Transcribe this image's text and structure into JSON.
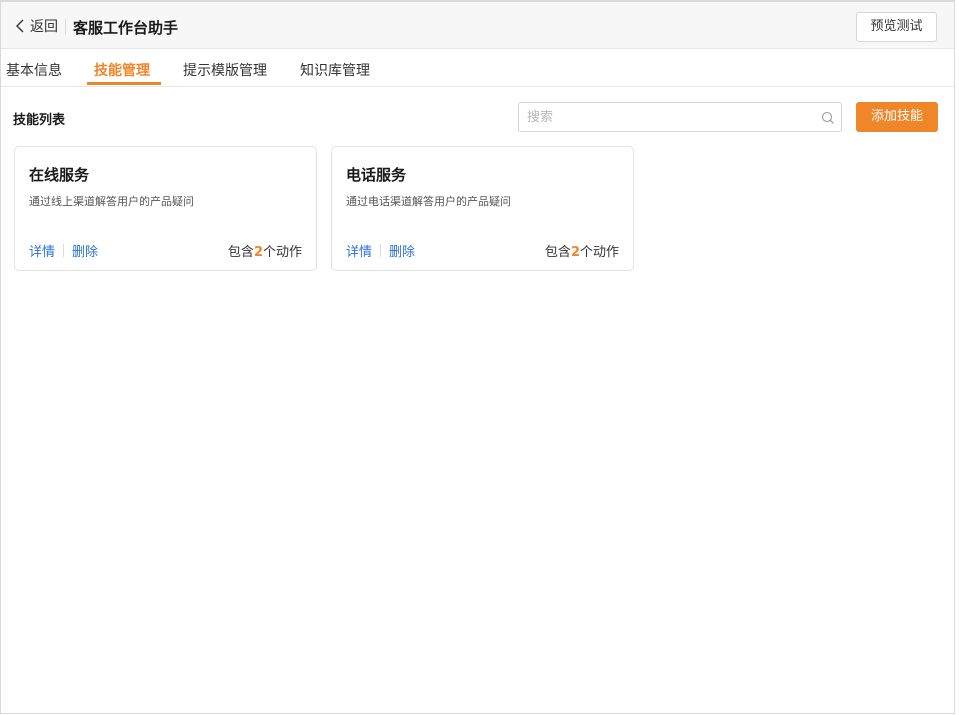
{
  "header": {
    "back_label": "返回",
    "title": "客服工作台助手",
    "preview_label": "预览测试"
  },
  "tabs": [
    {
      "label": "基本信息"
    },
    {
      "label": "技能管理"
    },
    {
      "label": "提示模版管理"
    },
    {
      "label": "知识库管理"
    }
  ],
  "active_tab": "技能管理",
  "skills": {
    "section_title": "技能列表",
    "search_placeholder": "搜索",
    "add_label": "添加技能",
    "cards": [
      {
        "title": "在线服务",
        "description": "通过线上渠道解答用户的产品疑问",
        "detail_label": "详情",
        "delete_label": "删除",
        "count_prefix": "包含",
        "count": "2",
        "count_suffix": "个动作"
      },
      {
        "title": "电话服务",
        "description": "通过电话渠道解答用户的产品疑问",
        "detail_label": "详情",
        "delete_label": "删除",
        "count_prefix": "包含",
        "count": "2",
        "count_suffix": "个动作"
      }
    ]
  },
  "colors": {
    "accent": "#f0862a",
    "link": "#2d6fd6"
  }
}
